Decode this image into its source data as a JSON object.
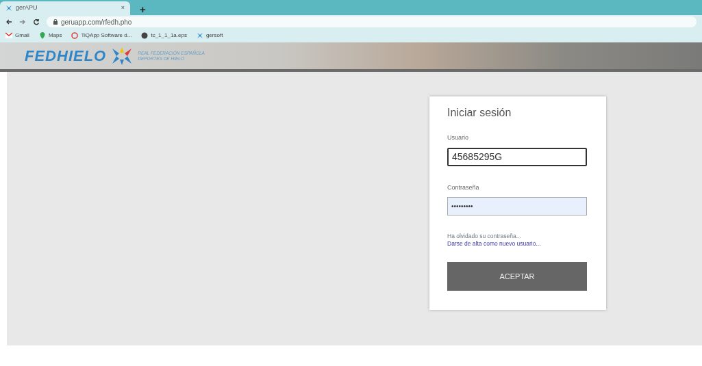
{
  "browser": {
    "tab": {
      "title": "gerAPU",
      "close": "×"
    },
    "new_tab": "+",
    "address": "geruapp.com/rfedh.pho",
    "bookmarks": [
      {
        "label": "Gmail"
      },
      {
        "label": "Maps"
      },
      {
        "label": "TiQApp Software d..."
      },
      {
        "label": "tc_1_1_1a.eps"
      },
      {
        "label": "gersoft"
      }
    ]
  },
  "header": {
    "logo": "FEDHIELO",
    "tagline_1": "REAL FEDERACIÓN ESPAÑOLA",
    "tagline_2": "DEPORTES DE HIELO"
  },
  "login": {
    "title": "Iniciar sesión",
    "fields": [
      {
        "label": "Usuario",
        "value": "45685295G",
        "focused": true,
        "autofilled": false
      },
      {
        "label": "Contraseña",
        "value": "•••••••••",
        "focused": false,
        "autofilled": true
      }
    ],
    "forgot": "Ha olvidado su contraseña...",
    "register": "Darse de alta como nuevo usuario...",
    "submit": "ACEPTAR"
  }
}
